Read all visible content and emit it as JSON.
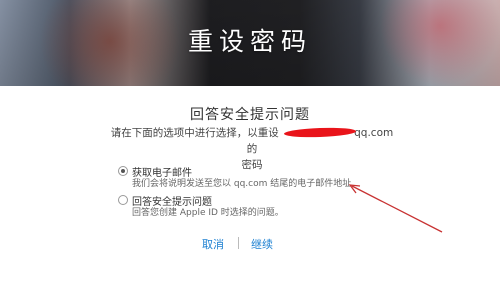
{
  "header": {
    "title": "重设密码"
  },
  "section": {
    "title": "回答安全提示问题",
    "desc_prefix": "请在下面的选项中进行选择，以重设",
    "email_suffix": "qq.com",
    "desc_suffix": "的",
    "desc_line2": "密码"
  },
  "options": [
    {
      "label": "获取电子邮件",
      "sub": "我们会将说明发送至您以 qq.com 结尾的电子邮件地址",
      "checked": true
    },
    {
      "label": "回答安全提示问题",
      "sub": "回答您创建 Apple ID 时选择的问题。",
      "checked": false
    }
  ],
  "actions": {
    "cancel": "取消",
    "continue": "继续"
  },
  "colors": {
    "link": "#1a7fd1",
    "annotation": "#c83232",
    "redaction": "#e9141a"
  }
}
